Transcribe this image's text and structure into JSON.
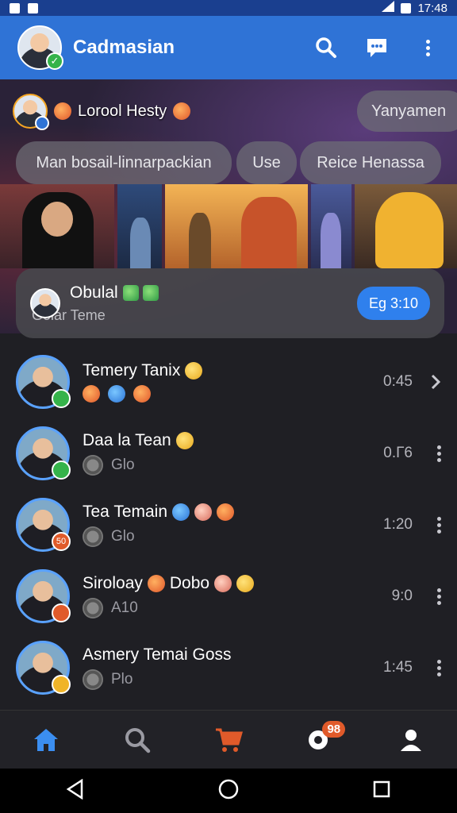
{
  "status_bar": {
    "time": "17:48"
  },
  "header": {
    "title": "Cadmasian",
    "avatar_check": "✓"
  },
  "stories": {
    "name": "Lorool Hesty"
  },
  "filters": {
    "top_pill": "Yanyamen",
    "pills": [
      "Man bosail-linnarpackian",
      "Use",
      "Reice Henassa"
    ]
  },
  "pinned": {
    "name": "Obulal",
    "subtitle": "Goiar Teme",
    "button": "Eg 3:10"
  },
  "chats": [
    {
      "name": "Temery Tanix",
      "sub": "",
      "time": "0:45",
      "action": "chevron",
      "badge_color": "#35b34a"
    },
    {
      "name": "Daa la Tean",
      "sub": "Glo",
      "time": "0.Г6",
      "action": "more",
      "badge_color": "#35b34a"
    },
    {
      "name": "Tea Temain",
      "sub": "Glo",
      "time": "1:20",
      "action": "more",
      "badge_color": "#e05a2a",
      "badge_text": "50"
    },
    {
      "name": "Siroloay",
      "name2": "Dobo",
      "sub": "A10",
      "time": "9:0",
      "action": "more",
      "badge_color": "#e05a2a"
    },
    {
      "name": "Asmery Temai Goss",
      "sub": "Plo",
      "time": "1:45",
      "action": "more",
      "badge_color": "#f0b429"
    }
  ],
  "bottom_nav": {
    "notifications_count": "98"
  },
  "colors": {
    "brand": "#2f73d6",
    "accent": "#e05a2a",
    "button": "#2f80ed"
  }
}
